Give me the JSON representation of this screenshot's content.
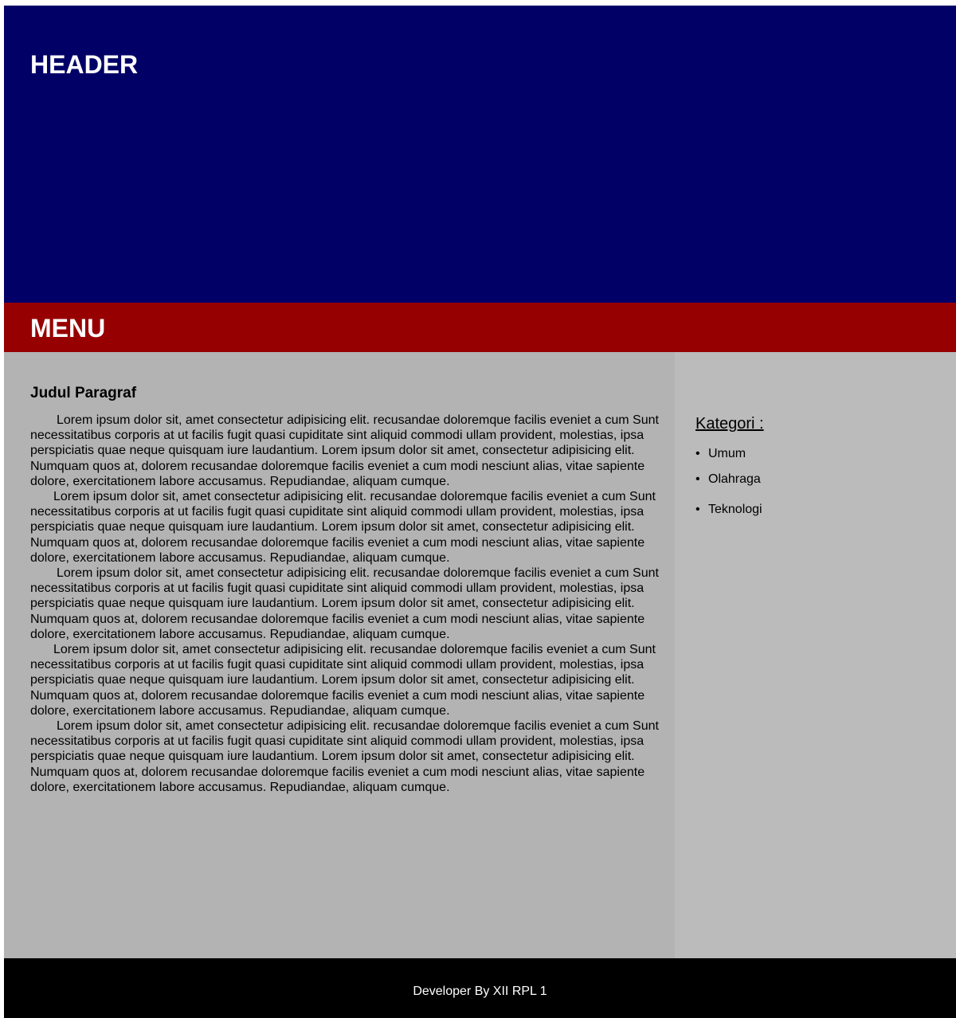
{
  "header": {
    "title": "HEADER"
  },
  "menu": {
    "title": "MENU"
  },
  "content": {
    "heading": "Judul Paragraf",
    "paragraphs": [
      "Lorem ipsum dolor sit, amet consectetur adipisicing elit. recusandae doloremque facilis eveniet a cum Sunt necessitatibus corporis at ut facilis fugit quasi cupiditate sint aliquid commodi ullam provident, molestias, ipsa perspiciatis quae neque quisquam iure laudantium. Lorem ipsum dolor sit amet, consectetur adipisicing elit. Numquam quos at, dolorem recusandae doloremque facilis eveniet a cum modi nesciunt alias, vitae sapiente dolore, exercitationem labore accusamus. Repudiandae, aliquam cumque.",
      "Lorem ipsum dolor sit, amet consectetur adipisicing elit. recusandae doloremque facilis eveniet a cum Sunt necessitatibus corporis at ut facilis fugit quasi cupiditate sint aliquid commodi ullam provident, molestias, ipsa perspiciatis quae neque quisquam iure laudantium. Lorem ipsum dolor sit amet, consectetur adipisicing elit. Numquam quos at, dolorem recusandae doloremque facilis eveniet a cum modi nesciunt alias, vitae sapiente dolore, exercitationem labore accusamus. Repudiandae, aliquam cumque.",
      "Lorem ipsum dolor sit, amet consectetur adipisicing elit. recusandae doloremque facilis eveniet a cum Sunt necessitatibus corporis at ut facilis fugit quasi cupiditate sint aliquid commodi ullam provident, molestias, ipsa perspiciatis quae neque quisquam iure laudantium. Lorem ipsum dolor sit amet, consectetur adipisicing elit. Numquam quos at, dolorem recusandae doloremque facilis eveniet a cum modi nesciunt alias, vitae sapiente dolore, exercitationem labore accusamus. Repudiandae, aliquam cumque.",
      "Lorem ipsum dolor sit, amet consectetur adipisicing elit. recusandae doloremque facilis eveniet a cum Sunt necessitatibus corporis at ut facilis fugit quasi cupiditate sint aliquid commodi ullam provident, molestias, ipsa perspiciatis quae neque quisquam iure laudantium. Lorem ipsum dolor sit amet, consectetur adipisicing elit. Numquam quos at, dolorem recusandae doloremque facilis eveniet a cum modi nesciunt alias, vitae sapiente dolore, exercitationem labore accusamus. Repudiandae, aliquam cumque.",
      "Lorem ipsum dolor sit, amet consectetur adipisicing elit. recusandae doloremque facilis eveniet a cum Sunt necessitatibus corporis at ut facilis fugit quasi cupiditate sint aliquid commodi ullam provident, molestias, ipsa perspiciatis quae neque quisquam iure laudantium. Lorem ipsum dolor sit amet, consectetur adipisicing elit. Numquam quos at, dolorem recusandae doloremque facilis eveniet a cum modi nesciunt alias, vitae sapiente dolore, exercitationem labore accusamus. Repudiandae, aliquam cumque."
    ]
  },
  "sidebar": {
    "title": "Kategori :",
    "items": [
      {
        "label": "Umum"
      },
      {
        "label": "Olahraga"
      },
      {
        "label": "Teknologi"
      }
    ]
  },
  "footer": {
    "text": "Developer By XII RPL 1"
  },
  "colors": {
    "header_bg": "#010066",
    "menu_bg": "#970000",
    "content_bg": "#b3b3b3",
    "sidebar_bg": "#bbbbbb",
    "footer_bg": "#000000"
  }
}
